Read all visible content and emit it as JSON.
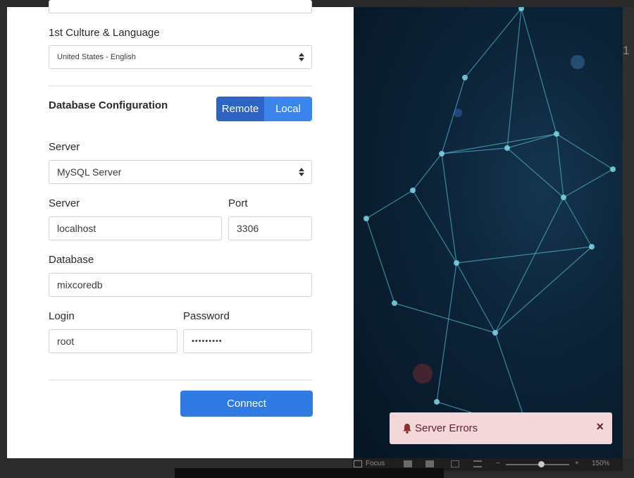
{
  "culture": {
    "label": "1st Culture & Language",
    "selected": "United States - English"
  },
  "database": {
    "heading": "Database Configuration",
    "mode_buttons": {
      "remote": "Remote",
      "local": "Local"
    },
    "server_type_label": "Server",
    "server_type_selected": "MySQL Server",
    "server_label": "Server",
    "server_value": "localhost",
    "port_label": "Port",
    "port_value": "3306",
    "db_label": "Database",
    "db_value": "mixcoredb",
    "login_label": "Login",
    "login_value": "root",
    "password_label": "Password",
    "password_value": "•••••••••",
    "connect_label": "Connect"
  },
  "toast": {
    "message": "Server Errors",
    "close": "×",
    "icon": "bell-icon",
    "color": "#f4d7d9"
  },
  "statusbar": {
    "focus_label": "Focus",
    "zoom_value": "150%"
  },
  "edge_text": "1",
  "colors": {
    "primary": "#2f7be3",
    "segment_active": "#2c63c4",
    "segment_inactive": "#3a84ec"
  }
}
